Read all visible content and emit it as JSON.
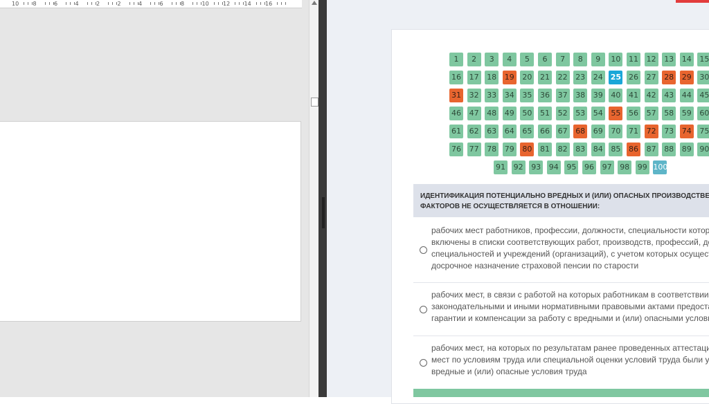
{
  "left": {
    "ruler_labels": [
      "10",
      "8",
      "6",
      "4",
      "2",
      "2",
      "4",
      "6",
      "8",
      "10",
      "12",
      "14",
      "16"
    ]
  },
  "quiz": {
    "rows": [
      {
        "row": 0,
        "offset": 0,
        "cells": [
          {
            "n": "1",
            "s": "done"
          },
          {
            "n": "2",
            "s": "done"
          },
          {
            "n": "3",
            "s": "done"
          },
          {
            "n": "4",
            "s": "done"
          },
          {
            "n": "5",
            "s": "done"
          },
          {
            "n": "6",
            "s": "done"
          },
          {
            "n": "7",
            "s": "done"
          },
          {
            "n": "8",
            "s": "done"
          },
          {
            "n": "9",
            "s": "done"
          },
          {
            "n": "10",
            "s": "done"
          },
          {
            "n": "11",
            "s": "done"
          },
          {
            "n": "12",
            "s": "done"
          },
          {
            "n": "13",
            "s": "done"
          },
          {
            "n": "14",
            "s": "done"
          },
          {
            "n": "15",
            "s": "done"
          }
        ]
      },
      {
        "row": 1,
        "offset": 0,
        "cells": [
          {
            "n": "16",
            "s": "done"
          },
          {
            "n": "17",
            "s": "done"
          },
          {
            "n": "18",
            "s": "done"
          },
          {
            "n": "19",
            "s": "wrong"
          },
          {
            "n": "20",
            "s": "done"
          },
          {
            "n": "21",
            "s": "done"
          },
          {
            "n": "22",
            "s": "done"
          },
          {
            "n": "23",
            "s": "done"
          },
          {
            "n": "24",
            "s": "done"
          },
          {
            "n": "25",
            "s": "current"
          },
          {
            "n": "26",
            "s": "done"
          },
          {
            "n": "27",
            "s": "done"
          },
          {
            "n": "28",
            "s": "wrong"
          },
          {
            "n": "29",
            "s": "wrong"
          },
          {
            "n": "30",
            "s": "done"
          }
        ]
      },
      {
        "row": 2,
        "offset": 0,
        "cells": [
          {
            "n": "31",
            "s": "wrong"
          },
          {
            "n": "32",
            "s": "done"
          },
          {
            "n": "33",
            "s": "done"
          },
          {
            "n": "34",
            "s": "done"
          },
          {
            "n": "35",
            "s": "done"
          },
          {
            "n": "36",
            "s": "done"
          },
          {
            "n": "37",
            "s": "done"
          },
          {
            "n": "38",
            "s": "done"
          },
          {
            "n": "39",
            "s": "done"
          },
          {
            "n": "40",
            "s": "done"
          },
          {
            "n": "41",
            "s": "done"
          },
          {
            "n": "42",
            "s": "done"
          },
          {
            "n": "43",
            "s": "done"
          },
          {
            "n": "44",
            "s": "done"
          },
          {
            "n": "45",
            "s": "done"
          }
        ]
      },
      {
        "row": 3,
        "offset": 0,
        "cells": [
          {
            "n": "46",
            "s": "done"
          },
          {
            "n": "47",
            "s": "done"
          },
          {
            "n": "48",
            "s": "done"
          },
          {
            "n": "49",
            "s": "done"
          },
          {
            "n": "50",
            "s": "done"
          },
          {
            "n": "51",
            "s": "done"
          },
          {
            "n": "52",
            "s": "done"
          },
          {
            "n": "53",
            "s": "done"
          },
          {
            "n": "54",
            "s": "done"
          },
          {
            "n": "55",
            "s": "wrong"
          },
          {
            "n": "56",
            "s": "done"
          },
          {
            "n": "57",
            "s": "done"
          },
          {
            "n": "58",
            "s": "done"
          },
          {
            "n": "59",
            "s": "done"
          },
          {
            "n": "60",
            "s": "done"
          }
        ]
      },
      {
        "row": 4,
        "offset": 0,
        "cells": [
          {
            "n": "61",
            "s": "done"
          },
          {
            "n": "62",
            "s": "done"
          },
          {
            "n": "63",
            "s": "done"
          },
          {
            "n": "64",
            "s": "done"
          },
          {
            "n": "65",
            "s": "done"
          },
          {
            "n": "66",
            "s": "done"
          },
          {
            "n": "67",
            "s": "done"
          },
          {
            "n": "68",
            "s": "wrong"
          },
          {
            "n": "69",
            "s": "done"
          },
          {
            "n": "70",
            "s": "done"
          },
          {
            "n": "71",
            "s": "done"
          },
          {
            "n": "72",
            "s": "wrong"
          },
          {
            "n": "73",
            "s": "done"
          },
          {
            "n": "74",
            "s": "wrong"
          },
          {
            "n": "75",
            "s": "done"
          }
        ]
      },
      {
        "row": 5,
        "offset": 0,
        "cells": [
          {
            "n": "76",
            "s": "done"
          },
          {
            "n": "77",
            "s": "done"
          },
          {
            "n": "78",
            "s": "done"
          },
          {
            "n": "79",
            "s": "done"
          },
          {
            "n": "80",
            "s": "wrong"
          },
          {
            "n": "81",
            "s": "done"
          },
          {
            "n": "82",
            "s": "done"
          },
          {
            "n": "83",
            "s": "done"
          },
          {
            "n": "84",
            "s": "done"
          },
          {
            "n": "85",
            "s": "done"
          },
          {
            "n": "86",
            "s": "wrong"
          },
          {
            "n": "87",
            "s": "done"
          },
          {
            "n": "88",
            "s": "done"
          },
          {
            "n": "89",
            "s": "done"
          },
          {
            "n": "90",
            "s": "done"
          }
        ]
      },
      {
        "row": 6,
        "offset": 2.5,
        "cells": [
          {
            "n": "91",
            "s": "done"
          },
          {
            "n": "92",
            "s": "done"
          },
          {
            "n": "93",
            "s": "done"
          },
          {
            "n": "94",
            "s": "done"
          },
          {
            "n": "95",
            "s": "done"
          },
          {
            "n": "96",
            "s": "done"
          },
          {
            "n": "97",
            "s": "done"
          },
          {
            "n": "98",
            "s": "done"
          },
          {
            "n": "99",
            "s": "done"
          },
          {
            "n": "100",
            "s": "pending"
          }
        ]
      }
    ],
    "question_title": "ИДЕНТИФИКАЦИЯ ПОТЕНЦИАЛЬНО ВРЕДНЫХ И (ИЛИ) ОПАСНЫХ ПРОИЗВОДСТВЕНН",
    "question_title_line2": "ФАКТОРОВ НЕ ОСУЩЕСТВЛЯЕТСЯ В ОТНОШЕНИИ:",
    "options": [
      {
        "lines": [
          "рабочих мест работников, профессии, должности, специальности которых",
          "включены в списки соответствующих работ, производств, профессий, долж",
          "специальностей и учреждений (организаций), с учетом которых осуществля",
          "досрочное назначение страховой пенсии по старости"
        ]
      },
      {
        "lines": [
          "рабочих мест, в связи с работой на которых работникам в соответствии с",
          "законодательными и иными нормативными правовыми актами предостав",
          "гарантии и компенсации за работу с вредными и (или) опасными условиям"
        ]
      },
      {
        "lines": [
          "рабочих мест, на которых по результатам ранее проведенных аттестации р",
          "мест по условиям труда или специальной оценки условий труда были уста",
          "вредные и (или) опасные условия труда"
        ]
      }
    ]
  },
  "colors": {
    "done": "#7fc7a0",
    "wrong": "#e8652f",
    "current": "#1aa7d8",
    "pending": "#5eb5c8"
  }
}
